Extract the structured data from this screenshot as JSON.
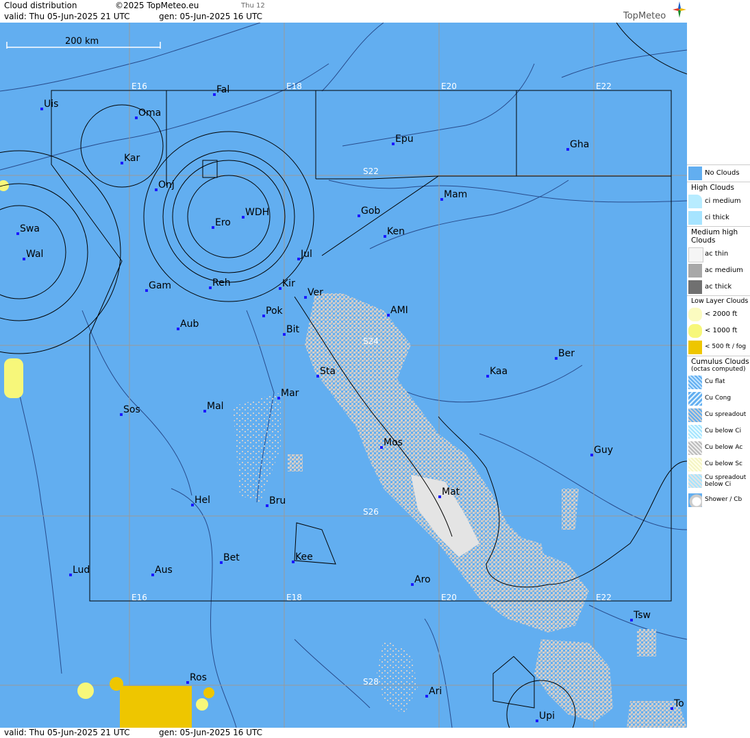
{
  "header": {
    "title": "Cloud distribution",
    "copyright": "©2025 TopMeteo.eu",
    "day_code": "Thu 12",
    "valid": "valid:  Thu  05-Jun-2025  21 UTC",
    "gen": "gen: 05-Jun-2025 16 UTC",
    "logo": "TopMeteo"
  },
  "footer": {
    "valid": "valid:  Thu  05-Jun-2025  21 UTC",
    "gen": "gen: 05-Jun-2025 16 UTC"
  },
  "scale_label": "200 km",
  "grid_labels": {
    "lon_top": [
      "E16",
      "E18",
      "E20",
      "E22"
    ],
    "lon_bottom": [
      "E16",
      "E18",
      "E20",
      "E22"
    ],
    "lat": [
      "S22",
      "S24",
      "S26",
      "S28"
    ]
  },
  "places": [
    {
      "name": "Uis"
    },
    {
      "name": "Fal"
    },
    {
      "name": "Oma"
    },
    {
      "name": "Kar"
    },
    {
      "name": "Epu"
    },
    {
      "name": "Gha"
    },
    {
      "name": "Onj"
    },
    {
      "name": "Mam"
    },
    {
      "name": "Gob"
    },
    {
      "name": "WDH"
    },
    {
      "name": "Swa"
    },
    {
      "name": "Ero"
    },
    {
      "name": "Ken"
    },
    {
      "name": "Wal"
    },
    {
      "name": "Jul"
    },
    {
      "name": "Gam"
    },
    {
      "name": "Reh"
    },
    {
      "name": "Kir"
    },
    {
      "name": "Ver"
    },
    {
      "name": "AMI"
    },
    {
      "name": "Pok"
    },
    {
      "name": "Aub"
    },
    {
      "name": "Bit"
    },
    {
      "name": "Ber"
    },
    {
      "name": "Sta"
    },
    {
      "name": "Kaa"
    },
    {
      "name": "Mar"
    },
    {
      "name": "Sos"
    },
    {
      "name": "Mal"
    },
    {
      "name": "Mos"
    },
    {
      "name": "Guy"
    },
    {
      "name": "Mat"
    },
    {
      "name": "Hel"
    },
    {
      "name": "Bru"
    },
    {
      "name": "Bet"
    },
    {
      "name": "Kee"
    },
    {
      "name": "Lud"
    },
    {
      "name": "Aus"
    },
    {
      "name": "Aro"
    },
    {
      "name": "Tsw"
    },
    {
      "name": "Ros"
    },
    {
      "name": "Ari"
    },
    {
      "name": "Upi"
    },
    {
      "name": "To"
    }
  ],
  "legend": {
    "no_clouds": "No Clouds",
    "high_title": "High Clouds",
    "ci_medium": "ci medium",
    "ci_thick": "ci thick",
    "medium_title": "Medium high Clouds",
    "ac_thin": "ac thin",
    "ac_medium": "ac medium",
    "ac_thick": "ac thick",
    "low_title": "Low Layer Clouds",
    "low_2000": "< 2000 ft",
    "low_1000": "< 1000 ft",
    "low_500": "< 500 ft / fog",
    "cu_title": "Cumulus Clouds",
    "cu_sub": "(octas computed)",
    "cu_flat": "Cu flat",
    "cu_cong": "Cu Cong",
    "cu_spreadout": "Cu spreadout",
    "cu_below_ci": "Cu below Ci",
    "cu_below_ac": "Cu below Ac",
    "cu_below_sc": "Cu below Sc",
    "cu_spread_below_ci": "Cu spreadout below Ci",
    "shower": "Shower / Cb"
  },
  "colors": {
    "sea_map": "#62aef0",
    "cu_grey": "#c8c8c8",
    "fog": "#eec600",
    "low_yellow": "#f7f77a",
    "station": "#1a1aff"
  }
}
